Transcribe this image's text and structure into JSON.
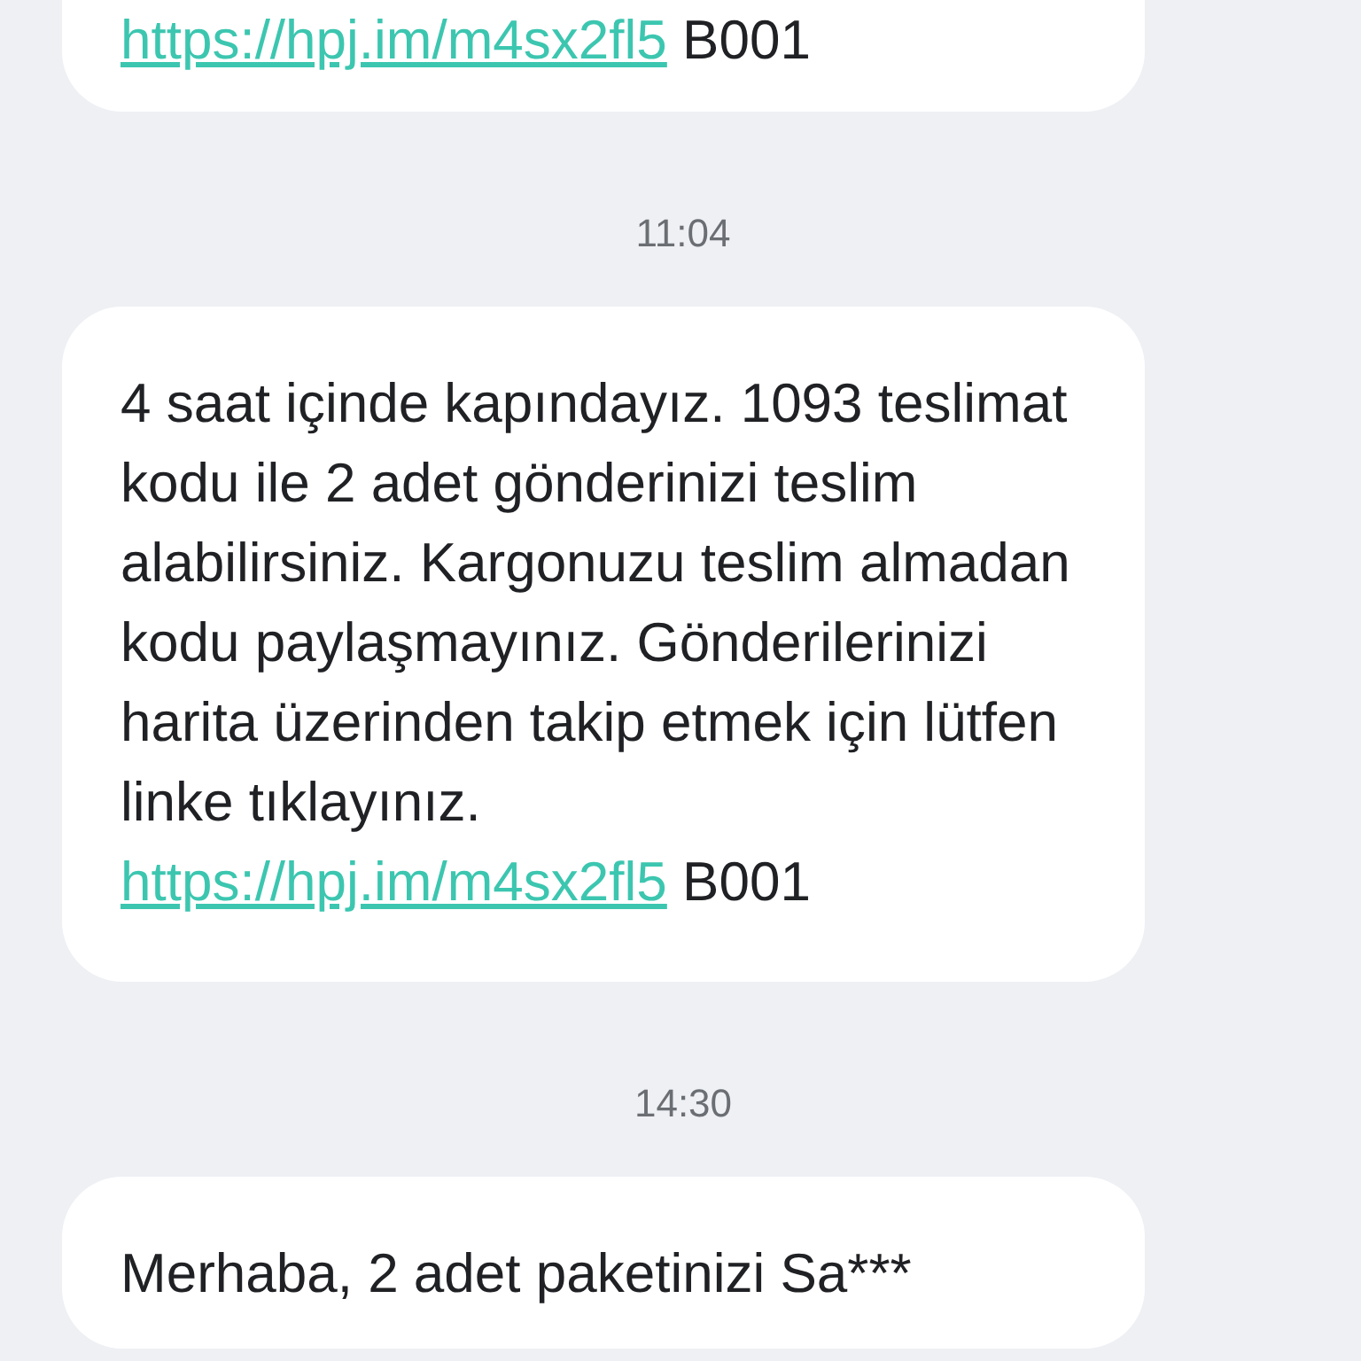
{
  "messages": [
    {
      "kind": "message",
      "link": "https://hpj.im/m4sx2fl5",
      "suffix": "B001"
    },
    {
      "kind": "time",
      "text": "11:04"
    },
    {
      "kind": "message",
      "text": "4 saat içinde kapındayız. 1093 teslimat kodu ile 2 adet gönderinizi teslim alabilirsiniz. Kargonuzu teslim almadan kodu paylaşmayınız. Gönderilerinizi harita üzerinden takip etmek için lütfen linke tıklayınız.",
      "link": "https://hpj.im/m4sx2fl5",
      "suffix": "B001"
    },
    {
      "kind": "time",
      "text": "14:30"
    },
    {
      "kind": "message",
      "text": "Merhaba, 2 adet paketinizi Sa***"
    }
  ]
}
